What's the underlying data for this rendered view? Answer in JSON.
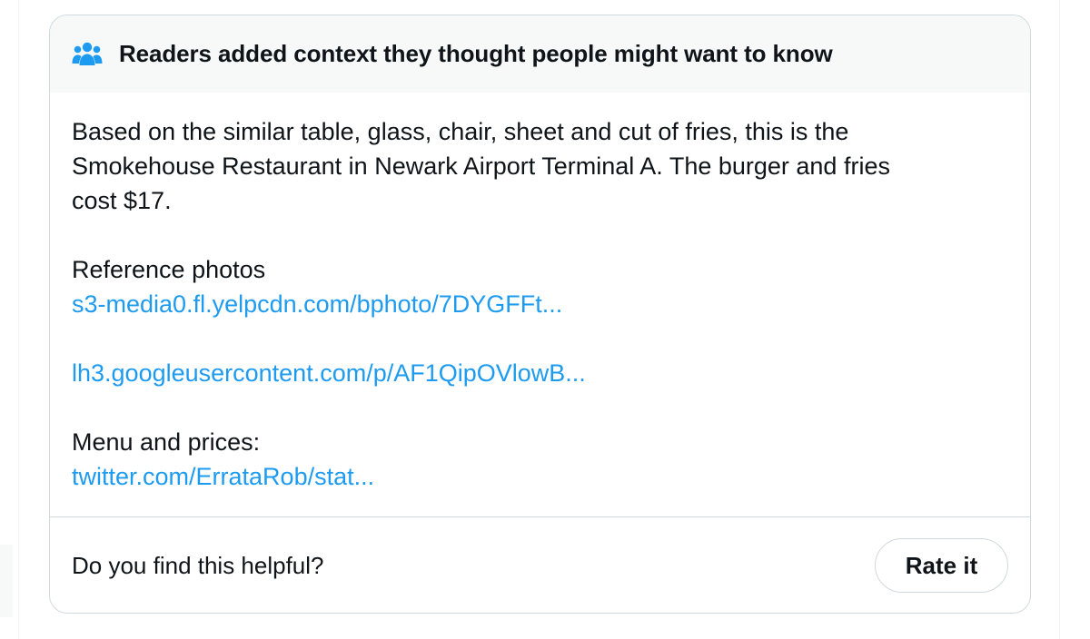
{
  "header": {
    "title": "Readers added context they thought people might want to know",
    "icon": "people-icon",
    "icon_color": "#1d9bf0"
  },
  "note": {
    "lines": [
      "Based on the similar table, glass, chair, sheet and cut of fries, this is the",
      "Smokehouse Restaurant in Newark Airport Terminal A. The burger and fries",
      "cost $17."
    ],
    "reference_label": "Reference photos",
    "links": {
      "yelp": "s3-media0.fl.yelpcdn.com/bphoto/7DYGFFt...",
      "google": "lh3.googleusercontent.com/p/AF1QipOVlowB...",
      "twitter": "twitter.com/ErrataRob/stat..."
    },
    "menu_label": "Menu and prices:"
  },
  "footer": {
    "question": "Do you find this helpful?",
    "rate_label": "Rate it"
  },
  "colors": {
    "link": "#1d9bf0",
    "header_bg": "#f7f9f9",
    "border": "#cfd9de",
    "text": "#0f1419"
  }
}
